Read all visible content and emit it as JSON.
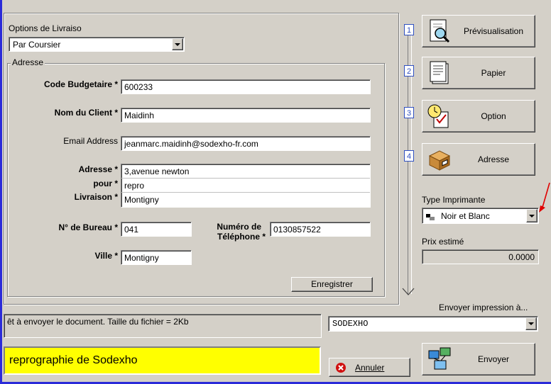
{
  "delivery": {
    "options_label": "Options de Livraiso",
    "options_value": "Par Coursier",
    "address_group": "Adresse"
  },
  "form": {
    "code_label": "Code Budgetaire *",
    "code_value": "600233",
    "client_label": "Nom du Client *",
    "client_value": "Maidinh",
    "email_label": "Email Address",
    "email_value": "jeanmarc.maidinh@sodexho-fr.com",
    "address_label_1": "Adresse *",
    "address_label_2": "pour *",
    "address_label_3": "Livraison *",
    "address_line_1": "3,avenue newton",
    "address_line_2": "repro",
    "address_line_3": "Montigny",
    "bureau_label": "N° de Bureau *",
    "bureau_value": "041",
    "phone_label_1": "Numéro de",
    "phone_label_2": "Téléphone *",
    "phone_value": "0130857522",
    "city_label": "Ville *",
    "city_value": "Montigny",
    "save_button": "Enregistrer"
  },
  "steps": [
    {
      "number": "1",
      "label": "Prévisualisation",
      "icon": "preview-magnifier-icon"
    },
    {
      "number": "2",
      "label": "Papier",
      "icon": "paper-icon"
    },
    {
      "number": "3",
      "label": "Option",
      "icon": "option-clock-icon"
    },
    {
      "number": "4",
      "label": "Adresse",
      "icon": "address-package-icon"
    }
  ],
  "printer": {
    "type_label": "Type Imprimante",
    "type_value": "Noir et Blanc",
    "price_label": "Prix estimé",
    "price_value": "0.0000"
  },
  "status": {
    "message": "êt à envoyer le document. Taille du fichier = 2Kb",
    "send_to_label": "Envoyer impression à...",
    "send_to_value": "SODEXHO",
    "banner_text": "reprographie de Sodexho",
    "cancel_button": "Annuler",
    "send_button": "Envoyer"
  },
  "colors": {
    "banner_bg": "#ffff00",
    "frame_blue": "#2b2bd9",
    "arrow_red": "#e00000"
  }
}
